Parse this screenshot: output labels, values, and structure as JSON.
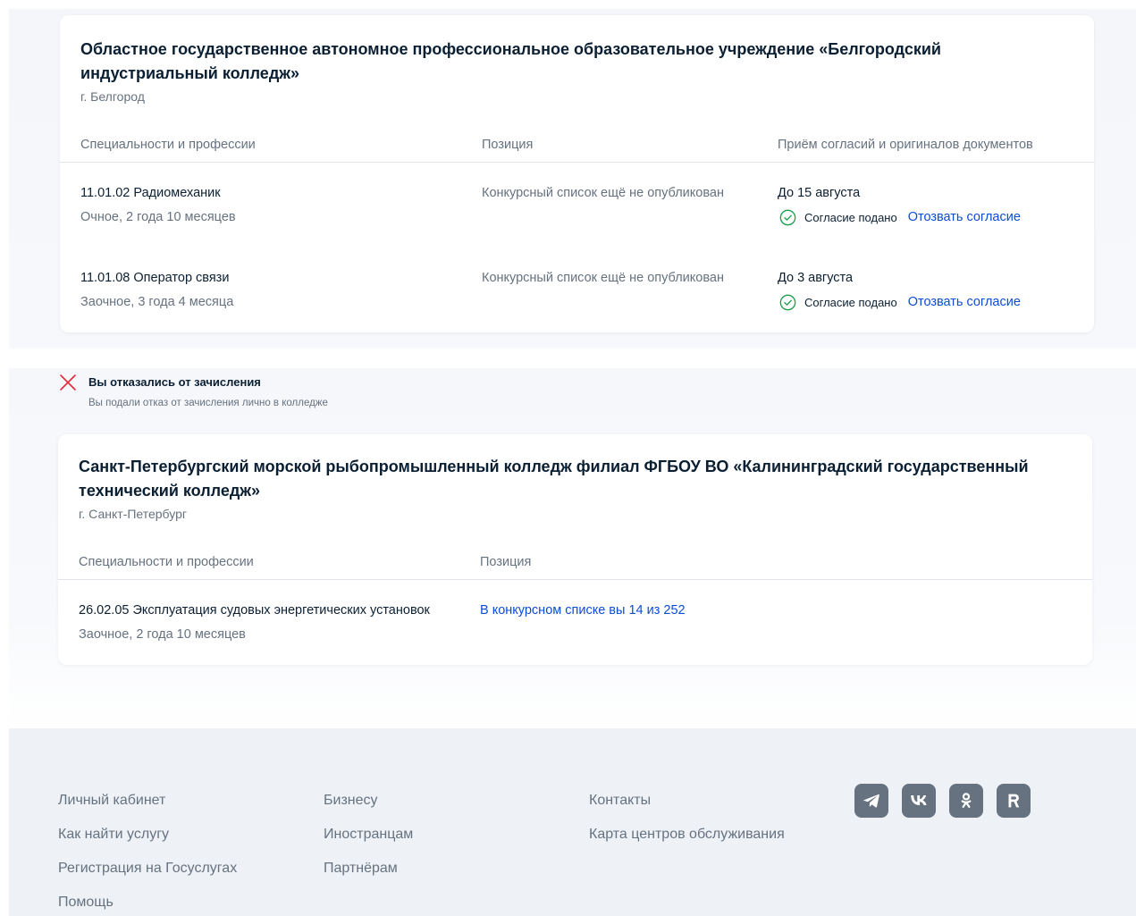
{
  "colors": {
    "text": "#0b1f33",
    "muted": "#66727f",
    "link": "#0d4cd3",
    "success": "#1a9e4a",
    "danger": "#e52b39",
    "footer_bg": "#eef2f7"
  },
  "applications": [
    {
      "title": "Областное государственное автономное профессиональное образовательное учреждение «Белгородский индустриальный колледж»",
      "city": "г. Белгород",
      "columns": {
        "specialty": "Специальности и профессии",
        "position": "Позиция",
        "consent": "Приём согласий и оригиналов документов"
      },
      "rows": [
        {
          "title": "11.01.02 Радиомеханик",
          "form": "Очное, 2 года 10 месяцев",
          "position": "Конкурсный список ещё не опубликован",
          "deadline": "До 15 августа",
          "consent_status": "Согласие подано",
          "consent_action": "Отозвать согласие",
          "consent_icon": "check-circle-icon"
        },
        {
          "title": "11.01.08 Оператор связи",
          "form": "Заочное, 3 года 4 месяца",
          "position": "Конкурсный список ещё не опубликован",
          "deadline": "До 3 августа",
          "consent_status": "Согласие подано",
          "consent_action": "Отозвать согласие",
          "consent_icon": "check-circle-icon"
        }
      ]
    },
    {
      "status": {
        "icon": "cross-icon",
        "title": "Вы отказались от зачисления",
        "description": "Вы подали отказ от зачисления лично в колледже"
      },
      "title": "Санкт-Петербургский морской рыбопромышленный колледж филиал ФГБОУ ВО «Калининградский государственный технический колледж»",
      "city": "г. Санкт-Петербург",
      "columns": {
        "specialty": "Специальности и профессии",
        "position": "Позиция"
      },
      "rows": [
        {
          "title": "26.02.05 Эксплуатация судовых энергетических установок",
          "form": "Заочное, 2 года 10 месяцев",
          "position": "В конкурсном списке вы 14 из 252"
        }
      ]
    }
  ],
  "footer": {
    "col1": [
      "Личный кабинет",
      "Как найти услугу",
      "Регистрация на Госуслугах",
      "Помощь"
    ],
    "col2": [
      "Бизнесу",
      "Иностранцам",
      "Партнёрам"
    ],
    "col3": [
      "Контакты",
      "Карта центров обслуживания"
    ],
    "socials": [
      "telegram-icon",
      "vk-icon",
      "odnoklassniki-icon",
      "rutube-icon"
    ]
  }
}
